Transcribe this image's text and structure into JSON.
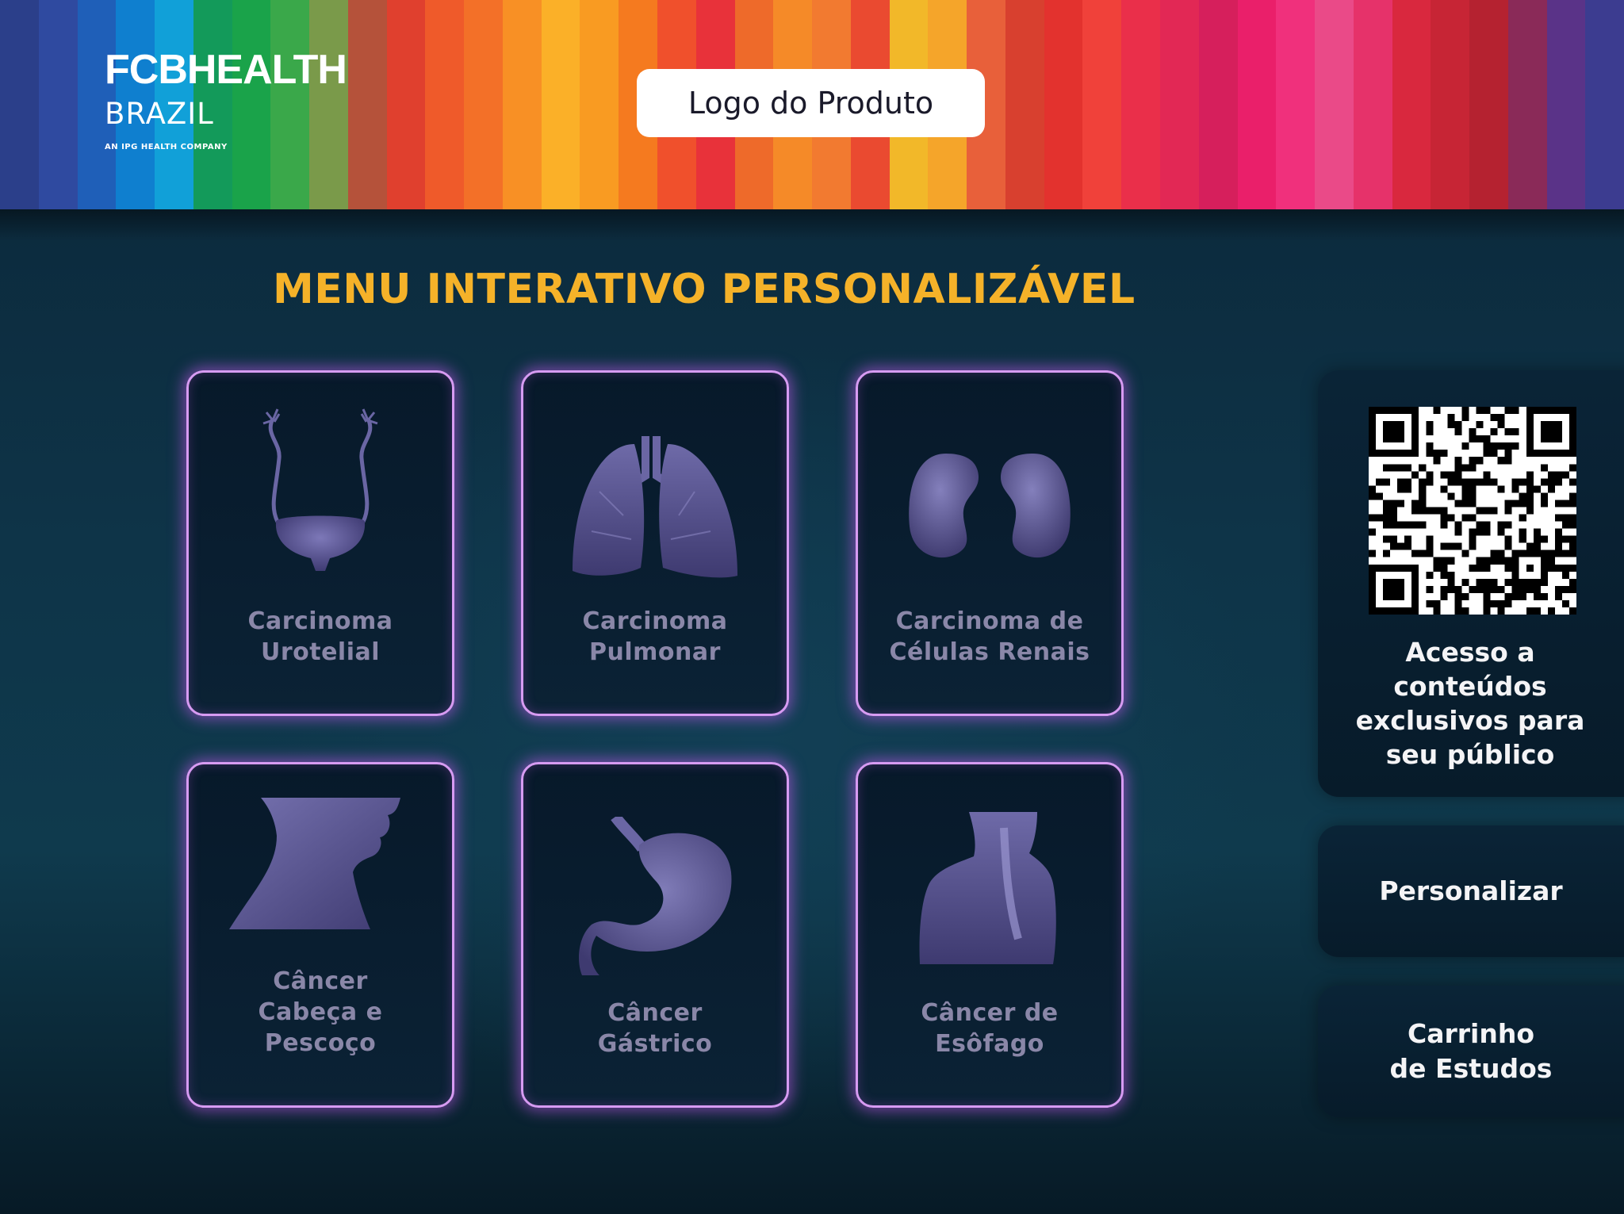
{
  "header": {
    "brand": {
      "name": "FCBHEALTH",
      "country": "BRAZIL",
      "tagline": "AN IPG HEALTH COMPANY"
    },
    "product_logo_label": "Logo do Produto",
    "stripe_colors": [
      "#2b3f8a",
      "#2f4aa0",
      "#1f5fb8",
      "#0f7fcf",
      "#11a0d8",
      "#139a5a",
      "#1aa34a",
      "#3aa84a",
      "#7a9a4a",
      "#b5523a",
      "#e0402e",
      "#ef5a2a",
      "#f37028",
      "#f89025",
      "#fbb028",
      "#f99b22",
      "#f57a1f",
      "#f0502c",
      "#e8323a",
      "#ee6a2a",
      "#f58a28",
      "#f27a30",
      "#ea4a30",
      "#f2b829",
      "#f5a52a",
      "#e8603a",
      "#d8402f",
      "#e3322e",
      "#f0413a",
      "#ea2f4a",
      "#e22855",
      "#d61f5c",
      "#ea1f6a",
      "#f0307c",
      "#ea4a88",
      "#e6326a",
      "#d9283e",
      "#c72535",
      "#b52230",
      "#8a2a58",
      "#5a3388",
      "#3c3c90"
    ]
  },
  "menu": {
    "title": "MENU INTERATIVO PERSONALIZÁVEL",
    "cards": [
      {
        "id": "urotelial",
        "lines": [
          "Carcinoma",
          "Urotelial"
        ],
        "icon": "bladder-icon"
      },
      {
        "id": "pulmonar",
        "lines": [
          "Carcinoma",
          "Pulmonar"
        ],
        "icon": "lungs-icon"
      },
      {
        "id": "renais",
        "lines": [
          "Carcinoma de",
          "Células Renais"
        ],
        "icon": "kidneys-icon"
      },
      {
        "id": "cabeca-pescoco",
        "lines": [
          "Câncer",
          "Cabeça e",
          "Pescoço"
        ],
        "icon": "neck-icon"
      },
      {
        "id": "gastrico",
        "lines": [
          "Câncer",
          "Gástrico"
        ],
        "icon": "stomach-icon"
      },
      {
        "id": "esofago",
        "lines": [
          "Câncer de",
          "Esôfago"
        ],
        "icon": "esophagus-icon"
      }
    ]
  },
  "sidebar": {
    "qr_text": [
      "Acesso a",
      "conteúdos",
      "exclusivos para",
      "seu público"
    ],
    "personalizar_label": "Personalizar",
    "carrinho_label": [
      "Carrinho",
      "de Estudos"
    ]
  },
  "colors": {
    "title": "#f5b229",
    "card_border": "#d79bf2",
    "card_label": "#8a87a8",
    "organ": "#5a5690"
  }
}
